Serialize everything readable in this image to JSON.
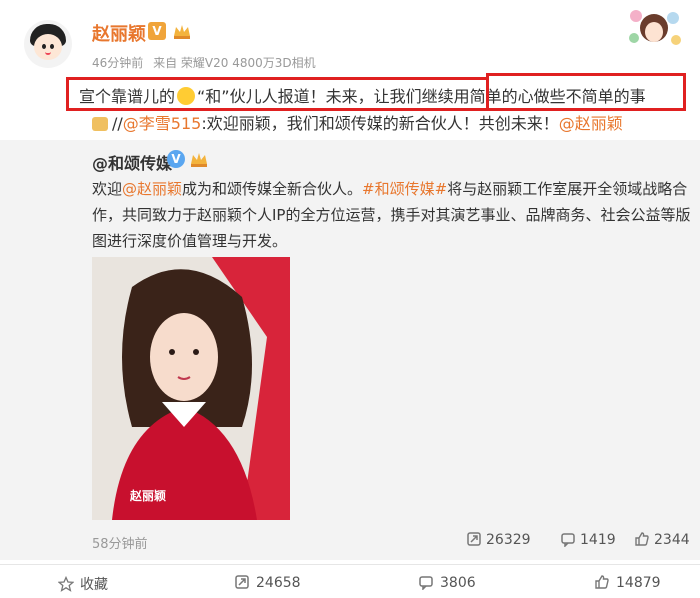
{
  "post": {
    "author": "赵丽颖",
    "verified_badge": "V",
    "time": "46分钟前",
    "source": "来自 荣耀V20 4800万3D相机",
    "text_part1": "宣个靠谱儿的",
    "text_part2": "“和”伙儿人报道！未来，让我们继续用",
    "text_highlight": "简单的心做些不简单的事",
    "repost_prefix": "//",
    "repost_mention": "@李雪515",
    "repost_text": ":欢迎丽颖，我们和颂传媒的新合伙人！共创未来！",
    "repost_mention2": "@赵丽颖"
  },
  "original": {
    "author": "@和颂传媒",
    "verified_badge": "V",
    "text_intro": "欢迎",
    "mention": "@赵丽颖",
    "text_mid": "成为和颂传媒全新合伙人。",
    "hashtag": "#和颂传媒#",
    "text_rest": "将与赵丽颖工作室展开全领域战略合作，共同致力于赵丽颖个人IP的全方位运营，携手对其演艺事业、品牌商务、社会公益等版图进行深度价值管理与开发。",
    "photo_caption": "赵丽颖",
    "time": "58分钟前",
    "reposts": "26329",
    "comments": "1419",
    "likes": "2344"
  },
  "actions": {
    "favorite": "收藏",
    "repost": "24658",
    "comment": "3806",
    "like": "14879"
  },
  "colors": {
    "accent_orange": "#e8772e",
    "highlight_red": "#e02020",
    "repost_bg": "#f3f3f3"
  },
  "icons": [
    "avatar-icon",
    "crown-icon",
    "emoji-icon",
    "gift-icon",
    "repost-icon",
    "comment-icon",
    "like-icon",
    "star-icon"
  ]
}
